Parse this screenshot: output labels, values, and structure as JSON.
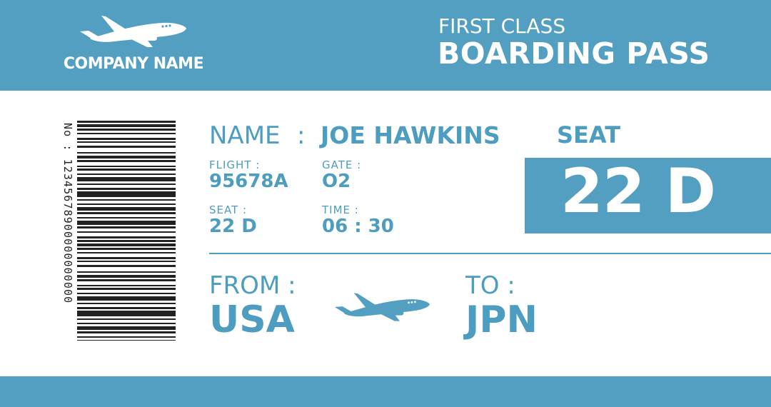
{
  "header": {
    "company_name": "COMPANY NAME",
    "class_label": "FIRST CLASS",
    "title": "BOARDING PASS",
    "logo_icon": "airplane-icon"
  },
  "barcode": {
    "number_text": "No : 12345678900000000000"
  },
  "passenger": {
    "name_label": "NAME",
    "name_colon": ":",
    "name_value": "JOE HAWKINS"
  },
  "details": {
    "flight_label": "FLIGHT :",
    "flight_value": "95678A",
    "gate_label": "GATE :",
    "gate_value": "O2",
    "seat_label": "SEAT :",
    "seat_value": "22 D",
    "time_label": "TIME :",
    "time_value": "06 : 30"
  },
  "seat_panel": {
    "heading": "SEAT",
    "value": "22 D"
  },
  "route": {
    "from_label": "FROM :",
    "from_value": "USA",
    "to_label": "TO :",
    "to_value": "JPN",
    "plane_icon": "airplane-icon"
  },
  "colors": {
    "accent": "#529fc1",
    "text_blue": "#4d9dc0",
    "barcode": "#222222",
    "white": "#ffffff"
  }
}
